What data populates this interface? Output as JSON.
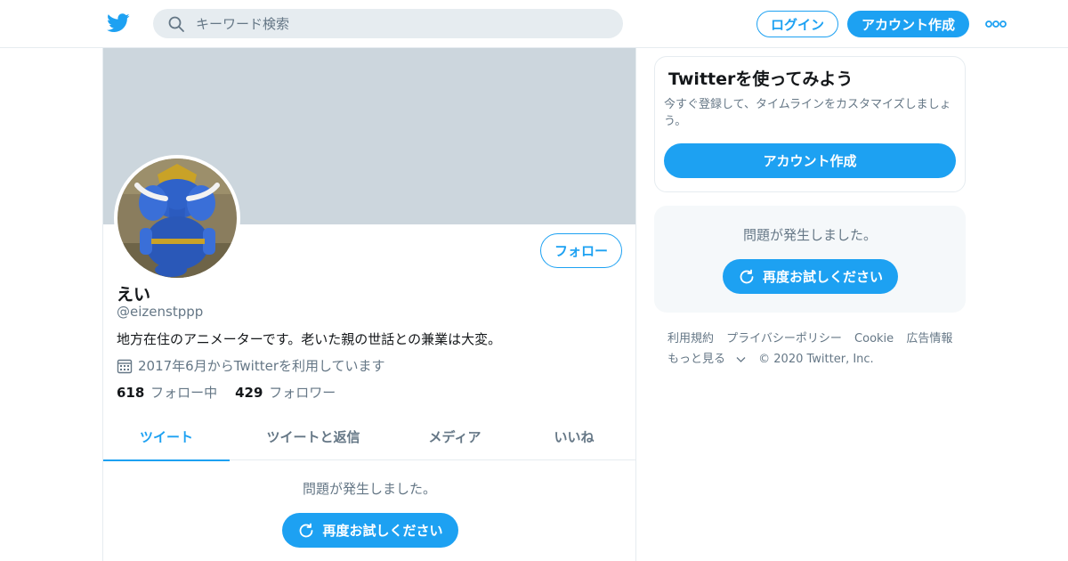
{
  "header": {
    "logo": "twitter-bird-icon",
    "search_placeholder": "キーワード検索",
    "login_label": "ログイン",
    "signup_label": "アカウント作成",
    "more_icon": "more-dots-icon"
  },
  "profile": {
    "name": "えい",
    "handle": "@eizenstppp",
    "bio": "地方在住のアニメーターです。老いた親の世話との兼業は大変。",
    "joined": "2017年6月からTwitterを利用しています",
    "following_count": "618",
    "following_label": "フォロー中",
    "followers_count": "429",
    "followers_label": "フォロワー",
    "follow_label": "フォロー"
  },
  "tabs": [
    {
      "label": "ツイート",
      "active": true
    },
    {
      "label": "ツイートと返信",
      "active": false
    },
    {
      "label": "メディア",
      "active": false
    },
    {
      "label": "いいね",
      "active": false
    }
  ],
  "timeline": {
    "error_text": "問題が発生しました。",
    "retry_label": "再度お試しください"
  },
  "sidebar": {
    "card_title": "Twitterを使ってみよう",
    "card_desc": "今すぐ登録して、タイムラインをカスタマイズしましょう。",
    "card_signup_label": "アカウント作成",
    "error_text": "問題が発生しました。",
    "retry_label": "再度お試しください"
  },
  "footer": {
    "links": [
      "利用規約",
      "プライバシーポリシー",
      "Cookie",
      "広告情報"
    ],
    "more_label": "もっと見る",
    "copyright": "© 2020 Twitter, Inc."
  },
  "colors": {
    "accent": "#1da1f2",
    "banner": "#ccd6dd",
    "muted_text": "#657786"
  }
}
